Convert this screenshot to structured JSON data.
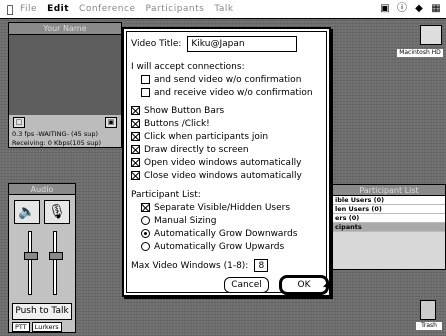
{
  "menubar": {
    "apple": "",
    "menus": [
      "File",
      "Edit",
      "Conference",
      "Participants",
      "Talk"
    ],
    "active_menu": "Edit"
  },
  "desktop": {
    "hd_label": "Macintosh HD",
    "trash_label": "Trash"
  },
  "video_window": {
    "title": "Your Name",
    "stat_line1": "0.3 fps  -WAITING-  (45 sup)",
    "stat_line2": "Receiving:      0 Kbps(105 sup)"
  },
  "audio_window": {
    "title": "Audio",
    "push_to_talk": "Push to Talk",
    "tab1": "PTT",
    "tab2": "Lurkers"
  },
  "participant_list": {
    "title": "Participant List",
    "rows": [
      "ible Users (0)",
      "len Users (0)",
      "ers (0)",
      "cipants"
    ]
  },
  "dialog": {
    "video_title_label": "Video Title:",
    "video_title_value": "Kiku@Japan",
    "accept_heading": "I will accept connections:",
    "accept_options": [
      {
        "label": "and send video w/o confirmation",
        "checked": false
      },
      {
        "label": "and receive video w/o confirmation",
        "checked": false
      }
    ],
    "options": [
      {
        "label": "Show Button Bars",
        "checked": true
      },
      {
        "label": "Buttons /Click!",
        "checked": true
      },
      {
        "label": "Click when participants join",
        "checked": true
      },
      {
        "label": "Draw directly to screen",
        "checked": true
      },
      {
        "label": "Open video windows automatically",
        "checked": true
      },
      {
        "label": "Close video windows automatically",
        "checked": true
      }
    ],
    "participant_heading": "Participant List:",
    "separate_label": "Separate Visible/Hidden Users",
    "separate_checked": true,
    "sizing_options": [
      {
        "label": "Manual Sizing",
        "selected": false
      },
      {
        "label": "Automatically Grow Downwards",
        "selected": true
      },
      {
        "label": "Automatically Grow Upwards",
        "selected": false
      }
    ],
    "max_windows_label": "Max Video Windows (1-8):",
    "max_windows_value": "8",
    "cancel_label": "Cancel",
    "ok_label": "OK"
  }
}
